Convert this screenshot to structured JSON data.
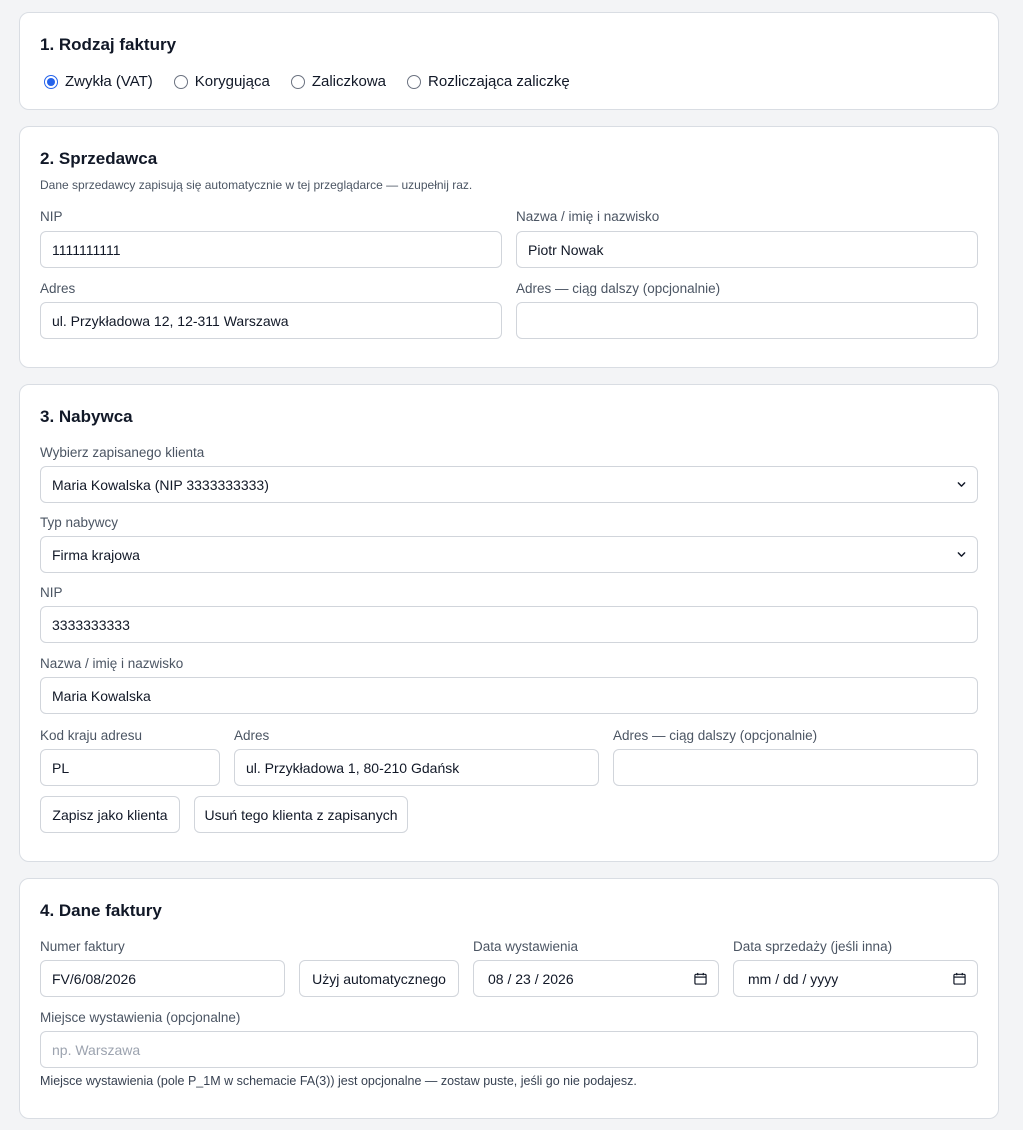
{
  "section1": {
    "title": "1. Rodzaj faktury",
    "options": [
      {
        "label": "Zwykła (VAT)",
        "checked": true
      },
      {
        "label": "Korygująca",
        "checked": false
      },
      {
        "label": "Zaliczkowa",
        "checked": false
      },
      {
        "label": "Rozliczająca zaliczkę",
        "checked": false
      }
    ]
  },
  "section2": {
    "title": "2. Sprzedawca",
    "hint": "Dane sprzedawcy zapisują się automatycznie w tej przeglądarce — uzupełnij raz.",
    "nip_label": "NIP",
    "nip_value": "1111111111",
    "name_label": "Nazwa / imię i nazwisko",
    "name_value": "Piotr Nowak",
    "address_label": "Adres",
    "address_value": "ul. Przykładowa 12, 12-311 Warszawa",
    "address2_label": "Adres — ciąg dalszy (opcjonalnie)",
    "address2_value": ""
  },
  "section3": {
    "title": "3. Nabywca",
    "client_label": "Wybierz zapisanego klienta",
    "client_value": "Maria Kowalska (NIP 3333333333)",
    "type_label": "Typ nabywcy",
    "type_value": "Firma krajowa",
    "nip_label": "NIP",
    "nip_value": "3333333333",
    "name_label": "Nazwa / imię i nazwisko",
    "name_value": "Maria Kowalska",
    "country_label": "Kod kraju adresu",
    "country_value": "PL",
    "address_label": "Adres",
    "address_value": "ul. Przykładowa 1, 80-210 Gdańsk",
    "address2_label": "Adres — ciąg dalszy (opcjonalnie)",
    "address2_value": "",
    "save_button": "Zapisz jako klienta",
    "delete_button": "Usuń tego klienta z zapisanych"
  },
  "section4": {
    "title": "4. Dane faktury",
    "number_label": "Numer faktury",
    "number_value": "FV/6/08/2026",
    "auto_button": "Użyj automatycznego",
    "issue_date_label": "Data wystawienia",
    "issue_date_value": "08 / 23 / 2026",
    "sale_date_label": "Data sprzedaży (jeśli inna)",
    "sale_date_value": "mm / dd / yyyy",
    "place_label": "Miejsce wystawienia (opcjonalne)",
    "place_placeholder": "np. Warszawa",
    "place_note": "Miejsce wystawienia (pole P_1M w schemacie FA(3)) jest opcjonalne — zostaw puste, jeśli go nie podajesz."
  },
  "icons": {
    "select": "chevron-down-icon",
    "date": "calendar-icon"
  },
  "colors": {
    "accent": "#2563eb",
    "border": "#d1d5db",
    "background": "#f3f4f6"
  }
}
